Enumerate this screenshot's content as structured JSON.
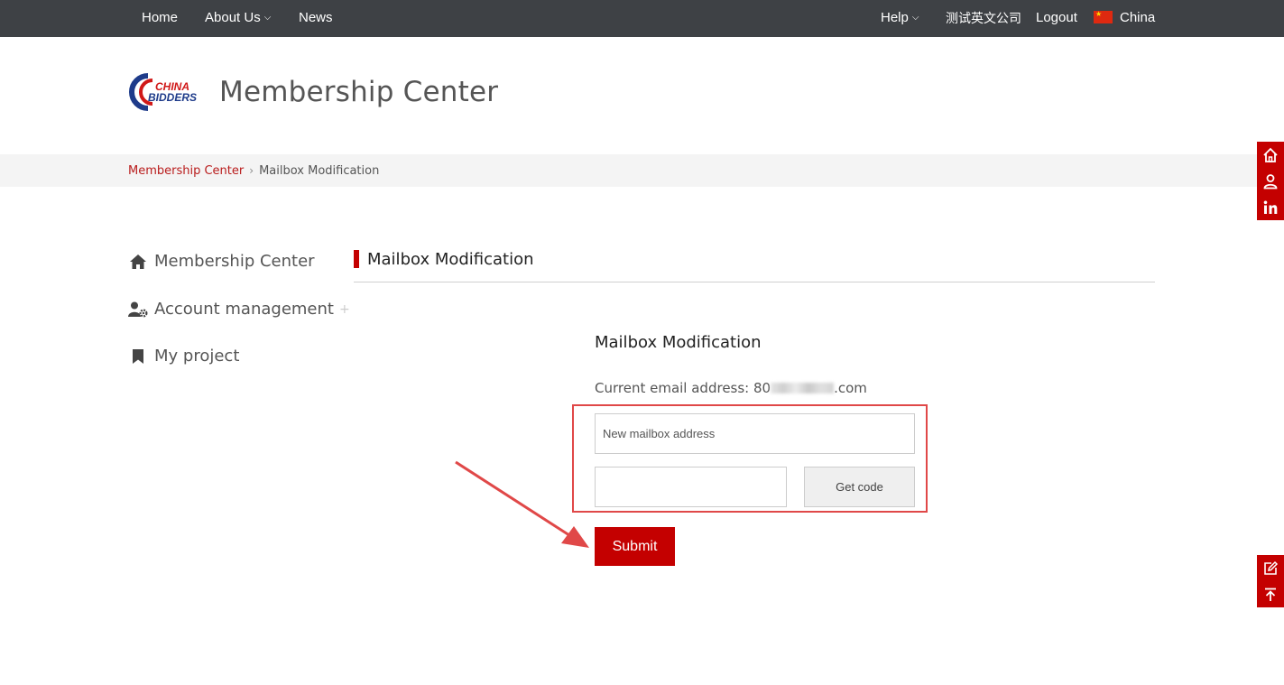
{
  "topnav": {
    "home": "Home",
    "about": "About Us",
    "news": "News",
    "help": "Help",
    "company": "测试英文公司",
    "logout": "Logout",
    "region": "China"
  },
  "header": {
    "logo_text_top": "CHINA",
    "logo_text_bottom": "BIDDERS",
    "title": "Membership Center"
  },
  "breadcrumb": {
    "root": "Membership Center",
    "separator": "›",
    "current": "Mailbox Modification"
  },
  "sidebar": {
    "items": [
      {
        "label": "Membership Center",
        "icon": "home-icon"
      },
      {
        "label": "Account management",
        "icon": "user-gear-icon",
        "expand": "+"
      },
      {
        "label": "My project",
        "icon": "bookmark-icon"
      }
    ]
  },
  "section": {
    "title": "Mailbox Modification"
  },
  "form": {
    "title": "Mailbox Modification",
    "current_email_label": "Current email address: ",
    "current_email_prefix": "80",
    "current_email_suffix": ".com",
    "new_email_placeholder": "New mailbox address",
    "code_value": "",
    "get_code_label": "Get code",
    "submit_label": "Submit"
  },
  "colors": {
    "brand_red": "#c40000",
    "topbar_bg": "#3e4145",
    "annotation_red": "#e04848"
  }
}
